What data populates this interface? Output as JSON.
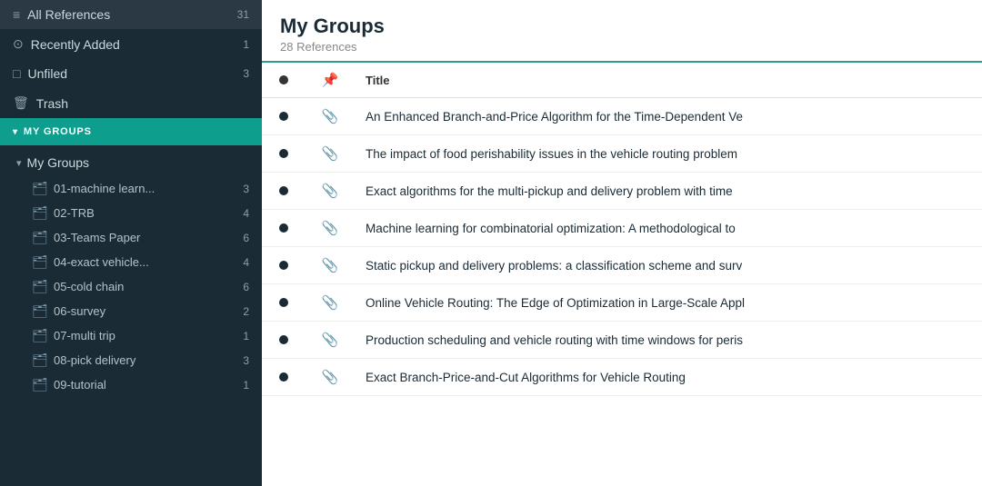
{
  "sidebar": {
    "background_color": "#1a2b35",
    "items": [
      {
        "id": "all-references",
        "label": "All References",
        "count": "31",
        "icon": "list"
      },
      {
        "id": "recently-added",
        "label": "Recently Added",
        "count": "1",
        "icon": "clock"
      },
      {
        "id": "unfiled",
        "label": "Unfiled",
        "count": "3",
        "icon": "file"
      },
      {
        "id": "trash",
        "label": "Trash",
        "count": "",
        "icon": "trash"
      }
    ],
    "my_groups_header": "MY GROUPS",
    "my_groups_label": "My Groups",
    "groups": [
      {
        "id": "g1",
        "label": "01-machine learn...",
        "count": "3"
      },
      {
        "id": "g2",
        "label": "02-TRB",
        "count": "4"
      },
      {
        "id": "g3",
        "label": "03-Teams Paper",
        "count": "6"
      },
      {
        "id": "g4",
        "label": "04-exact vehicle...",
        "count": "4"
      },
      {
        "id": "g5",
        "label": "05-cold chain",
        "count": "6"
      },
      {
        "id": "g6",
        "label": "06-survey",
        "count": "2"
      },
      {
        "id": "g7",
        "label": "07-multi trip",
        "count": "1"
      },
      {
        "id": "g8",
        "label": "08-pick delivery",
        "count": "3"
      },
      {
        "id": "g9",
        "label": "09-tutorial",
        "count": "1"
      }
    ]
  },
  "main": {
    "title": "My Groups",
    "subtitle": "28 References",
    "table": {
      "columns": [
        {
          "id": "read",
          "label": "●"
        },
        {
          "id": "attachment",
          "label": "⚇"
        },
        {
          "id": "title",
          "label": "Title"
        }
      ],
      "rows": [
        {
          "read": true,
          "attachment": true,
          "title": "An Enhanced Branch-and-Price Algorithm for the Time-Dependent Ve"
        },
        {
          "read": true,
          "attachment": true,
          "title": "The impact of food perishability issues in the vehicle routing problem"
        },
        {
          "read": true,
          "attachment": true,
          "title": "Exact algorithms for the multi-pickup and delivery problem with time"
        },
        {
          "read": true,
          "attachment": true,
          "title": "Machine learning for combinatorial optimization: A methodological to"
        },
        {
          "read": true,
          "attachment": true,
          "title": "Static pickup and delivery problems: a classification scheme and surv"
        },
        {
          "read": true,
          "attachment": true,
          "title": "Online Vehicle Routing: The Edge of Optimization in Large-Scale Appl"
        },
        {
          "read": true,
          "attachment": true,
          "title": "Production scheduling and vehicle routing with time windows for peris"
        },
        {
          "read": true,
          "attachment": true,
          "title": "Exact Branch-Price-and-Cut Algorithms for Vehicle Routing"
        }
      ]
    }
  }
}
